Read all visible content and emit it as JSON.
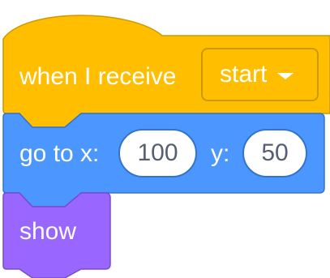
{
  "blocks": {
    "event_block": {
      "label": "when I receive",
      "message_dropdown": {
        "selected": "start"
      },
      "color": "#ffbf00",
      "border_color": "#cc9900"
    },
    "motion_block": {
      "label_x": "go to x:",
      "x_value": "100",
      "label_y": "y:",
      "y_value": "50",
      "color": "#4c97ff",
      "border_color": "#3373cc"
    },
    "looks_block": {
      "label": "show",
      "color": "#9966ff",
      "border_color": "#774dcb"
    }
  }
}
